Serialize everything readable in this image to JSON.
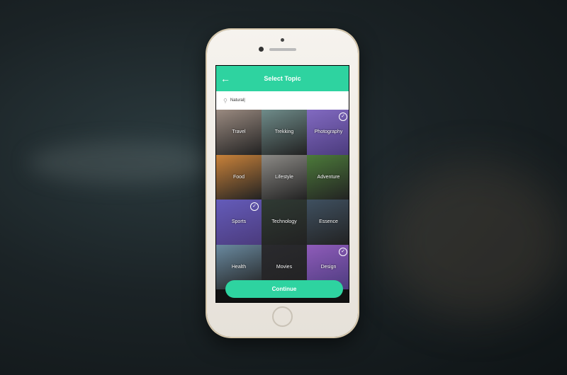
{
  "header": {
    "title": "Select Topic",
    "back_icon": "arrow-left-icon"
  },
  "search": {
    "value": "Natural",
    "icon": "search-icon"
  },
  "topics": [
    {
      "label": "Travel",
      "selected": false,
      "color": "#9a8a80"
    },
    {
      "label": "Trekking",
      "selected": false,
      "color": "#6f8c8a"
    },
    {
      "label": "Photography",
      "selected": true,
      "color": "#9b8ab8"
    },
    {
      "label": "Food",
      "selected": false,
      "color": "#c9823a"
    },
    {
      "label": "Lifestyle",
      "selected": false,
      "color": "#8c8a86"
    },
    {
      "label": "Adventure",
      "selected": false,
      "color": "#4c7a3a"
    },
    {
      "label": "Sports",
      "selected": true,
      "color": "#5a6aa8"
    },
    {
      "label": "Technology",
      "selected": false,
      "color": "#2f3a33"
    },
    {
      "label": "Essence",
      "selected": false,
      "color": "#3f5060"
    },
    {
      "label": "Health",
      "selected": false,
      "color": "#6a8aa0"
    },
    {
      "label": "Movies",
      "selected": false,
      "color": "#2a2a2e"
    },
    {
      "label": "Design",
      "selected": true,
      "color": "#b86aa8"
    }
  ],
  "continue_label": "Continue",
  "accent": "#2ed3a0"
}
